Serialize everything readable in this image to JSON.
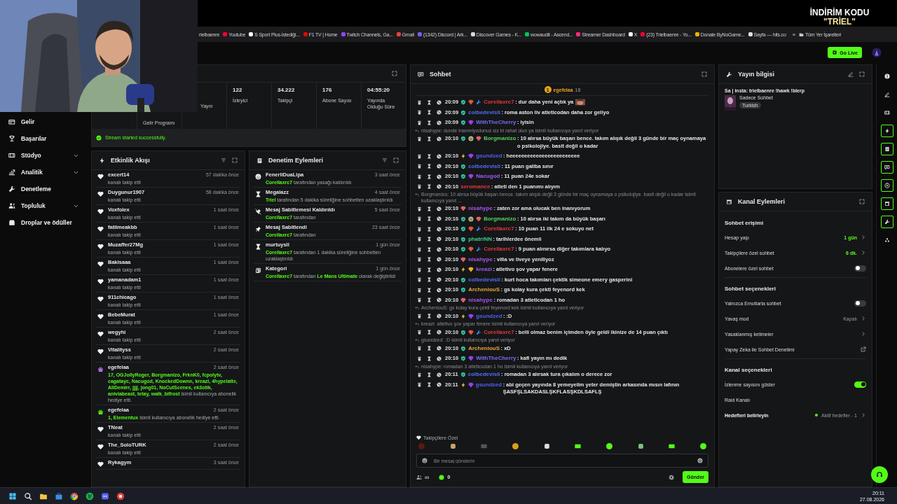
{
  "overlay": {
    "line1": "İNDİRİM KODU",
    "line2": "\"TRİEL\""
  },
  "bookmarks": [
    "rielbaenre",
    "Youtube",
    "S Sport Plus-İstediği...",
    "F1 TV | Home",
    "Twitch Channels, Ga...",
    "Gmail",
    "(1342) Discord | Ark...",
    "Discover Games - K...",
    "wowaudit - Ascend...",
    "Streamer Dashboard",
    "X",
    "(23) Trielbaenre - Yo...",
    "Donate ByNoGame...",
    "Sayfa — hits.co"
  ],
  "more_bookmarks": "»",
  "all_bookmarks": "Tüm Yer İşaretleri",
  "go_live": "Go Live",
  "sidebar": [
    {
      "label": "Gelir",
      "expandable": false
    },
    {
      "label": "Başarılar",
      "expandable": false
    },
    {
      "label": "Stüdyo",
      "expandable": true
    },
    {
      "label": "Analitik",
      "expandable": true
    },
    {
      "label": "Denetleme",
      "expandable": false
    },
    {
      "label": "Topluluk",
      "expandable": true
    },
    {
      "label": "Droplar ve ödüller",
      "expandable": false
    }
  ],
  "stats": [
    {
      "label": "Gelir Programı"
    },
    {
      "label": "Yayın"
    },
    {
      "value": "122",
      "label": "İzleyici"
    },
    {
      "value": "34.222",
      "label": "Takipçi"
    },
    {
      "value": "176",
      "label": "Abone Sayısı"
    },
    {
      "value": "04:55:20",
      "label": "Yayında Olduğu Süre"
    }
  ],
  "banner": "Stream started successfully.",
  "activity": {
    "title": "Etkinlik Akışı",
    "items": [
      {
        "kind": "follow",
        "name": "excert14",
        "time": "57 dakika önce",
        "text": "kanalı takip etti"
      },
      {
        "kind": "follow",
        "name": "Duygunur1907",
        "time": "58 dakika önce",
        "text": "kanalı takip etti"
      },
      {
        "kind": "follow",
        "name": "Voxfolex",
        "time": "1 saat önce",
        "text": "kanalı takip etti"
      },
      {
        "kind": "follow",
        "name": "fatiimeakbb",
        "time": "1 saat önce",
        "text": "kanalı takip etti"
      },
      {
        "kind": "follow",
        "name": "Muzaffer27Mg",
        "time": "1 saat önce",
        "text": "kanalı takip etti"
      },
      {
        "kind": "follow",
        "name": "Bakisaaa",
        "time": "1 saat önce",
        "text": "kanalı takip etti"
      },
      {
        "kind": "follow",
        "name": "yamanadam1",
        "time": "1 saat önce",
        "text": "kanalı takip etti"
      },
      {
        "kind": "follow",
        "name": "911chicago",
        "time": "1 saat önce",
        "text": "kanalı takip etti"
      },
      {
        "kind": "follow",
        "name": "BebeMurat",
        "time": "1 saat önce",
        "text": "kanalı takip etti"
      },
      {
        "kind": "follow",
        "name": "wegyhi",
        "time": "2 saat önce",
        "text": "kanalı takip etti"
      },
      {
        "kind": "follow",
        "name": "Vitalityss",
        "time": "2 saat önce",
        "text": "kanalı takip etti"
      },
      {
        "kind": "gift",
        "color": "#b57cf0",
        "name": "egefelaa",
        "time": "2 saat önce",
        "text": "**17, OGJollyRoger, Borgmanizo, FrknK0, fcpolytv, cagatayc, Nacugod, KnockedDownn, kreazi, 4hypelatte, AliDemirr, jjjj, jong01, NoCutScenes, ek3otik, aniviabeast, tetay, walk_bifrost** isimli kullanıcıya abonelik hediye etti."
      },
      {
        "kind": "gift",
        "color": "#53fc18",
        "name": "egefelaa",
        "time": "2 saat önce",
        "text": "**1, Elementux** isimli kullanıcıya abonelik hediye etti."
      },
      {
        "kind": "follow",
        "name": "TNeat",
        "time": "2 saat önce",
        "text": "kanalı takip etti"
      },
      {
        "kind": "follow",
        "name": "The_SoloTURK",
        "time": "2 saat önce",
        "text": "kanalı takip etti"
      },
      {
        "kind": "follow",
        "name": "Rykagym",
        "time": "3 saat önce"
      }
    ]
  },
  "moderation": {
    "title": "Denetim Eylemleri",
    "items": [
      {
        "kind": "unban",
        "name": "FenerliDuaLipa",
        "time": "3 saat önce",
        "text": "**Corellaxrc7** tarafından yasağı kaldırıldı"
      },
      {
        "kind": "timeout",
        "name": "Megalazz",
        "time": "4 saat önce",
        "text": "**Triel** tarafından 5 dakika süreliğine sohbetten uzaklaştırıldı"
      },
      {
        "kind": "unpin",
        "name": "Mesaj Sabitlemesi Kaldırıldı",
        "time": "5 saat önce",
        "text": "**Corellaxrc7** tarafından"
      },
      {
        "kind": "pin",
        "name": "Mesaj Sabitlendi",
        "time": "23 saat önce",
        "text": "**Corellaxrc7** tarafından"
      },
      {
        "kind": "timeout",
        "name": "murtuysll",
        "time": "1 gün önce",
        "text": "**Corellaxrc7** tarafından 1 dakika süreliğine sohbetten uzaklaştırıldı"
      },
      {
        "kind": "category",
        "name": "Kategori",
        "time": "1 gün önce",
        "text": "**Corellaxrc7** tarafından **Le Mans Ultimate** olarak değiştirildi"
      }
    ]
  },
  "chat": {
    "title": "Sohbet",
    "leader": {
      "rank": "1",
      "name": "egefelaa",
      "count": "18"
    },
    "messages": [
      {
        "kind": "message",
        "time": "20:09",
        "badges": [
          {
            "kind": "sub"
          },
          {
            "kind": "gem",
            "color": "#e0553a"
          },
          {
            "kind": "hammer"
          }
        ],
        "user": "Corellaxrc7",
        "color": "#e5383b",
        "text": ": dur daha yeni açtık ya",
        "emote": true
      },
      {
        "kind": "message",
        "time": "20:09",
        "badges": [
          {
            "kind": "sub"
          }
        ],
        "user": "colbedevisli",
        "color": "#4f6ef7",
        "text": ": roma aston liv atleticodan daha zor geliyo"
      },
      {
        "kind": "message",
        "time": "20:09",
        "badges": [
          {
            "kind": "sub"
          },
          {
            "kind": "gem",
            "color": "#9b3cf5"
          }
        ],
        "user": "WithTheCherry",
        "color": "#7a6cf7",
        "text": ": iyisin"
      },
      {
        "kind": "reply",
        "text": "nisahype: dunde inanmiyodunuz siz bi rahat olun ya isimli kullanıcıya yanıt veriyor"
      },
      {
        "kind": "message",
        "time": "20:10",
        "badges": [
          {
            "kind": "sub"
          },
          {
            "kind": "helmet"
          },
          {
            "kind": "gem",
            "color": "#e0606a"
          }
        ],
        "user": "Borgmanizo",
        "color": "#55d35a",
        "text": ": 10 alırsa büyük başarı bence. takım alışık değil 3 günde bir maç oynamaya o psikolojiye. basit değil o kadar"
      },
      {
        "kind": "message",
        "time": "20:10",
        "badges": [
          {
            "kind": "star"
          },
          {
            "kind": "gem",
            "color": "#9b3cf5"
          }
        ],
        "user": "gsundzed",
        "color": "#4f5ff0",
        "text": ": heeeeeeeeeeeeeeeeeeeeeeee"
      },
      {
        "kind": "message",
        "time": "20:10",
        "badges": [
          {
            "kind": "sub"
          }
        ],
        "user": "colbedevisli",
        "color": "#4f6ef7",
        "text": ": 11 puan galiba sınır"
      },
      {
        "kind": "message",
        "time": "20:10",
        "badges": [
          {
            "kind": "sub"
          },
          {
            "kind": "gem",
            "color": "#9b3cf5"
          }
        ],
        "user": "Nacugod",
        "color": "#9b5cf5",
        "text": ": 11 puan 24e sokar"
      },
      {
        "kind": "message",
        "time": "20:10",
        "user": "seromance",
        "color": "#e5383b",
        "text": ": atleti den 1 puanımı alıyım"
      },
      {
        "kind": "reply",
        "text": "Borgmanizo: 10 alırsa büyük başarı bence. takım alışık değil 3 günde bir maç oynamaya o psikolojiye. basit değil o kadar isimli kullanıcıya yanıt ..."
      },
      {
        "kind": "message",
        "time": "20:10",
        "badges": [
          {
            "kind": "gem",
            "color": "#e0606a"
          }
        ],
        "user": "nisahype",
        "color": "#a855f0",
        "text": ": zaten zor ama olucak ben inanıyorum"
      },
      {
        "kind": "message",
        "time": "20:10",
        "badges": [
          {
            "kind": "sub"
          },
          {
            "kind": "helmet"
          },
          {
            "kind": "gem",
            "color": "#e0606a"
          }
        ],
        "user": "Borgmanizo",
        "color": "#55d35a",
        "text": ": 10 alırsa iki takım da büyük başarı"
      },
      {
        "kind": "message",
        "time": "20:10",
        "badges": [
          {
            "kind": "sub"
          },
          {
            "kind": "gem",
            "color": "#e0553a"
          },
          {
            "kind": "hammer"
          }
        ],
        "user": "Corellaxrc7",
        "color": "#e5383b",
        "text": ": 10 puan 11 ilk 24 e sokuyo net"
      },
      {
        "kind": "message",
        "time": "20:10",
        "badges": [
          {
            "kind": "sub"
          }
        ],
        "user": "phatriNN",
        "color": "#3fcf8e",
        "text": ": tarihlerdee önemli"
      },
      {
        "kind": "message",
        "time": "20:10",
        "badges": [
          {
            "kind": "sub"
          },
          {
            "kind": "gem",
            "color": "#e0553a"
          },
          {
            "kind": "hammer"
          }
        ],
        "user": "Corellaxrc7",
        "color": "#e5383b",
        "text": ": 9 puan alınırsa diğer takımlara kalıyo"
      },
      {
        "kind": "message",
        "time": "20:10",
        "badges": [
          {
            "kind": "gem",
            "color": "#e0606a"
          }
        ],
        "user": "nisahype",
        "color": "#a855f0",
        "text": ": villa ve liveye yeniliyoz"
      },
      {
        "kind": "message",
        "time": "20:10",
        "badges": [
          {
            "kind": "star"
          },
          {
            "kind": "gem",
            "color": "#e8b020"
          }
        ],
        "user": "kreazi",
        "color": "#9b5cf5",
        "text": ": atletivo şov yapar fenere"
      },
      {
        "kind": "message",
        "time": "20:10",
        "badges": [
          {
            "kind": "sub"
          }
        ],
        "user": "colbedevisli",
        "color": "#4f6ef7",
        "text": ": kurt hoca takımları çektik simeone emery gasperini"
      },
      {
        "kind": "message",
        "time": "20:10",
        "badges": [
          {
            "kind": "sub"
          }
        ],
        "user": "ArcheniouS",
        "color": "#e8a63c",
        "text": ": gs kolay kura çekti feyenord kek"
      },
      {
        "kind": "message",
        "time": "20:10",
        "badges": [
          {
            "kind": "gem",
            "color": "#e0606a"
          }
        ],
        "user": "nisahype",
        "color": "#a855f0",
        "text": ": romadan 3 atleticodan 1 ho"
      },
      {
        "kind": "reply",
        "text": "ArcheniouS: gs kolay kura çekti feyenord kek isimli kullanıcıya yanıt veriyor"
      },
      {
        "kind": "message",
        "time": "20:10",
        "badges": [
          {
            "kind": "star"
          },
          {
            "kind": "gem",
            "color": "#9b3cf5"
          }
        ],
        "user": "gsundzed",
        "color": "#4f5ff0",
        "text": ": :D"
      },
      {
        "kind": "reply",
        "text": "kreazi: atletivo şov yapar fenere isimli kullanıcıya yanıt veriyor"
      },
      {
        "kind": "message",
        "time": "20:10",
        "badges": [
          {
            "kind": "sub"
          },
          {
            "kind": "gem",
            "color": "#e0553a"
          },
          {
            "kind": "hammer"
          }
        ],
        "user": "Corellaxrc7",
        "color": "#e5383b",
        "text": ": belli olmaz benim içimden öyle geldi ikinize de 14 puan çıktı"
      },
      {
        "kind": "reply",
        "text": "gsundzed: :D isimli kullanıcıya yanıt veriyor"
      },
      {
        "kind": "message",
        "time": "20:10",
        "badges": [
          {
            "kind": "sub"
          }
        ],
        "user": "ArcheniouS",
        "color": "#e8a63c",
        "text": ": xD"
      },
      {
        "kind": "message",
        "time": "20:10",
        "badges": [
          {
            "kind": "sub"
          },
          {
            "kind": "gem",
            "color": "#9b3cf5"
          }
        ],
        "user": "WithTheCherry",
        "color": "#7a6cf7",
        "text": ": kafi yayın mı dedik"
      },
      {
        "kind": "reply",
        "text": "nisahype: romadan 3 atleticodan 1 ho isimli kullanıcıya yanıt veriyor"
      },
      {
        "kind": "message",
        "time": "20:11",
        "badges": [
          {
            "kind": "sub"
          }
        ],
        "user": "colbedevisli",
        "color": "#4f6ef7",
        "text": ": romadan 3 alırsak tura çıkalım o derece zor"
      },
      {
        "kind": "message",
        "time": "20:11",
        "badges": [
          {
            "kind": "star"
          },
          {
            "kind": "gem",
            "color": "#9b3cf5"
          }
        ],
        "user": "gsundzed",
        "color": "#4f5ff0",
        "text": ": abi geçen yayında 8 yemeyelim yeter demiştin arkasında mısın lafının ŞASFŞLSAKDASLŞKFLASŞKDLSAFLŞ"
      }
    ],
    "followers_label": "Takipçilere Özel",
    "placeholder": "Bir mesaj gönderin",
    "infinity": "∞",
    "points": "0",
    "send": "Gönder"
  },
  "stream_info": {
    "title": "Yayın bilgisi",
    "stream_title": "Sa | insta: trielbaenre !hawk !blerp",
    "category": "Sadece Sohbet",
    "tag": "Turkish"
  },
  "channel_actions": {
    "title": "Kanal Eylemleri",
    "sections": [
      {
        "title": "Sohbet erişimi",
        "rows": [
          {
            "kind": "value",
            "label": "Hesap yaşı",
            "value": "1 gün"
          },
          {
            "kind": "value",
            "label": "Takipçilere özel sohbet",
            "value": "6 dk."
          },
          {
            "kind": "toggle",
            "label": "Abonelere özel sohbet",
            "on": false
          }
        ]
      },
      {
        "title": "Sohbet seçenekleri",
        "rows": [
          {
            "kind": "toggle",
            "label": "Yalnızca Emotlarla sohbet",
            "on": false
          },
          {
            "kind": "setting",
            "label": "Yavaş mod",
            "value": "Kapalı"
          },
          {
            "kind": "link",
            "label": "Yasaklanmış kelimeler"
          },
          {
            "kind": "external",
            "label": "Yapay Zeka ile Sohbet Denetimi"
          }
        ]
      },
      {
        "title": "Kanal seçenekleri",
        "rows": [
          {
            "kind": "toggle",
            "label": "İzlenme sayısını göster",
            "on": true
          },
          {
            "kind": "plain",
            "label": "Raid Kanalı"
          },
          {
            "kind": "status",
            "label": "Hedefleri belirleyin",
            "value": "Aktif hedefler - 1"
          }
        ]
      }
    ]
  },
  "rail": [
    {
      "open": false
    },
    {
      "open": false
    },
    {
      "open": false
    },
    {
      "open": true
    },
    {
      "open": true
    },
    {
      "open": true
    },
    {
      "open": true
    },
    {
      "open": true
    },
    {
      "open": true
    },
    {
      "open": false
    }
  ],
  "clock": {
    "time": "20:11",
    "date": "27.08.2026"
  }
}
